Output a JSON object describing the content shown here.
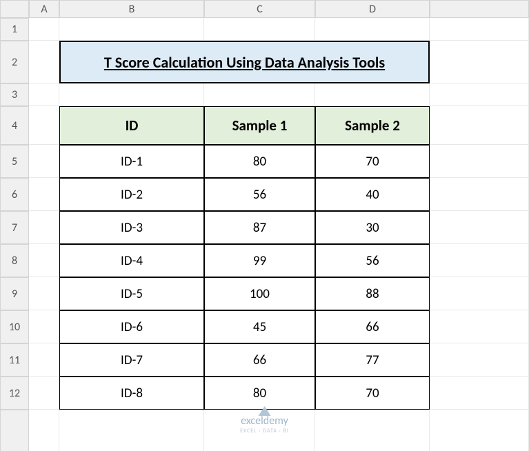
{
  "columns": [
    "A",
    "B",
    "C",
    "D"
  ],
  "row_numbers": [
    1,
    2,
    3,
    4,
    5,
    6,
    7,
    8,
    9,
    10,
    11,
    12
  ],
  "title": "T Score Calculation Using Data Analysis Tools",
  "table": {
    "headers": [
      "ID",
      "Sample 1",
      "Sample 2"
    ],
    "rows": [
      {
        "id": "ID-1",
        "s1": "80",
        "s2": "70"
      },
      {
        "id": "ID-2",
        "s1": "56",
        "s2": "40"
      },
      {
        "id": "ID-3",
        "s1": "87",
        "s2": "30"
      },
      {
        "id": "ID-4",
        "s1": "99",
        "s2": "56"
      },
      {
        "id": "ID-5",
        "s1": "100",
        "s2": "88"
      },
      {
        "id": "ID-6",
        "s1": "45",
        "s2": "66"
      },
      {
        "id": "ID-7",
        "s1": "66",
        "s2": "77"
      },
      {
        "id": "ID-8",
        "s1": "80",
        "s2": "70"
      }
    ]
  },
  "watermark": {
    "main": "exceldemy",
    "sub": "EXCEL · DATA · BI"
  },
  "chart_data": {
    "type": "table",
    "title": "T Score Calculation Using Data Analysis Tools",
    "columns": [
      "ID",
      "Sample 1",
      "Sample 2"
    ],
    "rows": [
      [
        "ID-1",
        80,
        70
      ],
      [
        "ID-2",
        56,
        40
      ],
      [
        "ID-3",
        87,
        30
      ],
      [
        "ID-4",
        99,
        56
      ],
      [
        "ID-5",
        100,
        88
      ],
      [
        "ID-6",
        45,
        66
      ],
      [
        "ID-7",
        66,
        77
      ],
      [
        "ID-8",
        80,
        70
      ]
    ]
  }
}
